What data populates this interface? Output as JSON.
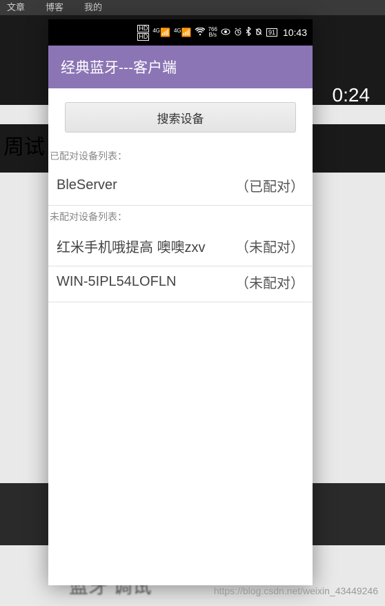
{
  "background": {
    "nav_items": [
      "文章",
      "博客",
      "我的"
    ],
    "time_fragment": "0:24",
    "partial_text_1": "周试",
    "bottom_text": "蓝牙 调试"
  },
  "status_bar": {
    "hd": "HD",
    "net_label": "4G",
    "speed_value": "766",
    "speed_unit": "B/s",
    "battery": "91",
    "time": "10:43"
  },
  "app": {
    "title": "经典蓝牙---客户端",
    "search_button": "搜索设备",
    "paired_label": "已配对设备列表：",
    "unpaired_label": "未配对设备列表：",
    "paired_devices": [
      {
        "name": "BleServer",
        "status": "（已配对）"
      }
    ],
    "unpaired_devices": [
      {
        "name": "红米手机哦提高 噢噢zxv",
        "status": "（未配对）"
      },
      {
        "name": "WIN-5IPL54LOFLN",
        "status": "（未配对）"
      }
    ]
  },
  "watermark": "https://blog.csdn.net/weixin_43449246"
}
